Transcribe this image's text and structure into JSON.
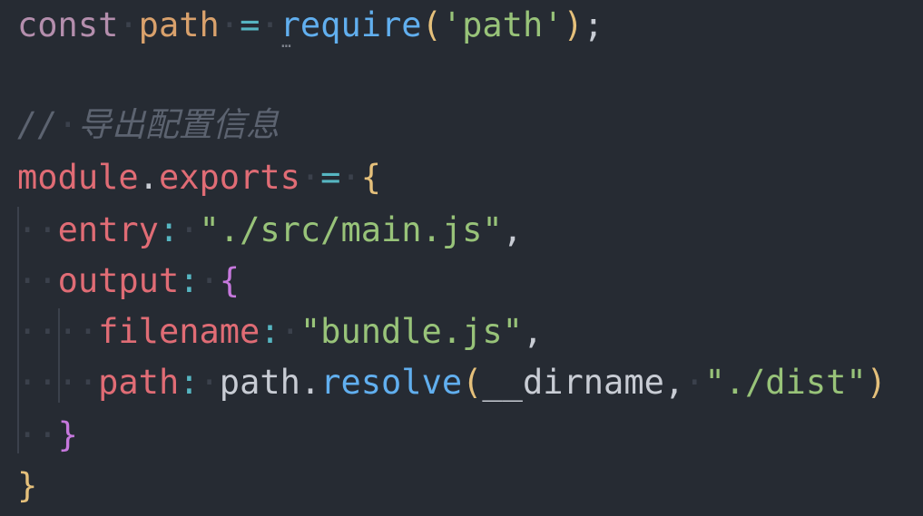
{
  "editor": {
    "lines": [
      [
        {
          "t": "const",
          "c": "kw"
        },
        {
          "t": "·",
          "c": "ws"
        },
        {
          "t": "path",
          "c": "var"
        },
        {
          "t": "·",
          "c": "ws"
        },
        {
          "t": "=",
          "c": "op"
        },
        {
          "t": "·",
          "c": "ws"
        },
        {
          "t": "require",
          "c": "fn"
        },
        {
          "t": "(",
          "c": "paren"
        },
        {
          "t": "'path'",
          "c": "str"
        },
        {
          "t": ")",
          "c": "paren"
        },
        {
          "t": ";",
          "c": "punct"
        }
      ],
      [],
      [
        {
          "t": "//",
          "c": "comment"
        },
        {
          "t": "·",
          "c": "ws"
        },
        {
          "t": "导出配置信息",
          "c": "comment"
        }
      ],
      [
        {
          "t": "module",
          "c": "prop"
        },
        {
          "t": ".",
          "c": "punct"
        },
        {
          "t": "exports",
          "c": "prop"
        },
        {
          "t": "·",
          "c": "ws"
        },
        {
          "t": "=",
          "c": "op"
        },
        {
          "t": "·",
          "c": "ws"
        },
        {
          "t": "{",
          "c": "brace-gold"
        }
      ],
      [
        {
          "t": "·",
          "c": "ws"
        },
        {
          "t": "·",
          "c": "ws"
        },
        {
          "t": "entry",
          "c": "prop"
        },
        {
          "t": ":",
          "c": "op"
        },
        {
          "t": "·",
          "c": "ws"
        },
        {
          "t": "\"./src/main.js\"",
          "c": "str"
        },
        {
          "t": ",",
          "c": "punct"
        }
      ],
      [
        {
          "t": "·",
          "c": "ws"
        },
        {
          "t": "·",
          "c": "ws"
        },
        {
          "t": "output",
          "c": "prop"
        },
        {
          "t": ":",
          "c": "op"
        },
        {
          "t": "·",
          "c": "ws"
        },
        {
          "t": "{",
          "c": "brace-pink"
        }
      ],
      [
        {
          "t": "·",
          "c": "ws"
        },
        {
          "t": "·",
          "c": "ws"
        },
        {
          "t": "·",
          "c": "ws"
        },
        {
          "t": "·",
          "c": "ws"
        },
        {
          "t": "filename",
          "c": "prop"
        },
        {
          "t": ":",
          "c": "op"
        },
        {
          "t": "·",
          "c": "ws"
        },
        {
          "t": "\"bundle.js\"",
          "c": "str"
        },
        {
          "t": ",",
          "c": "punct"
        }
      ],
      [
        {
          "t": "·",
          "c": "ws"
        },
        {
          "t": "·",
          "c": "ws"
        },
        {
          "t": "·",
          "c": "ws"
        },
        {
          "t": "·",
          "c": "ws"
        },
        {
          "t": "path",
          "c": "prop"
        },
        {
          "t": ":",
          "c": "op"
        },
        {
          "t": "·",
          "c": "ws"
        },
        {
          "t": "path",
          "c": "plain"
        },
        {
          "t": ".",
          "c": "punct"
        },
        {
          "t": "resolve",
          "c": "fn"
        },
        {
          "t": "(",
          "c": "paren"
        },
        {
          "t": "__dirname",
          "c": "plain"
        },
        {
          "t": ",",
          "c": "punct"
        },
        {
          "t": "·",
          "c": "ws"
        },
        {
          "t": "\"./dist\"",
          "c": "str"
        },
        {
          "t": ")",
          "c": "paren"
        }
      ],
      [
        {
          "t": "·",
          "c": "ws"
        },
        {
          "t": "·",
          "c": "ws"
        },
        {
          "t": "}",
          "c": "brace-pink"
        }
      ],
      [
        {
          "t": "}",
          "c": "brace-gold"
        }
      ]
    ],
    "hint": "…"
  }
}
